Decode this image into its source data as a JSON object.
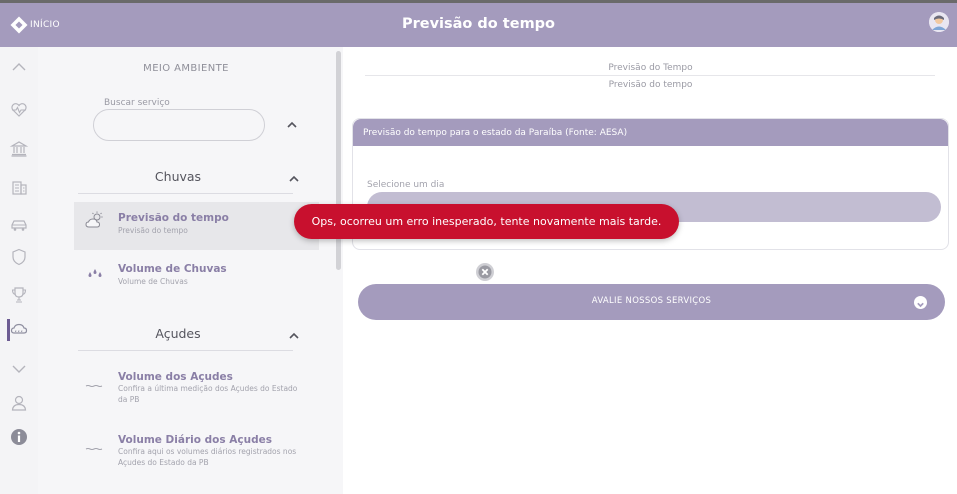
{
  "header": {
    "home_label": "INÍCIO",
    "title": "Previsão do tempo",
    "avatar_icon": "user-avatar-icon"
  },
  "rail": {
    "icons": [
      "chevron-up-icon",
      "heartbeat-icon",
      "bank-building-icon",
      "office-building-icon",
      "car-icon",
      "shield-icon",
      "trophy-icon",
      "cloud-rain-icon",
      "chevron-down-icon",
      "user-icon",
      "info-icon"
    ],
    "active": "cloud-rain-icon"
  },
  "menu": {
    "section_title": "MEIO AMBIENTE",
    "search_label": "Buscar serviço",
    "search_value": "",
    "groups": [
      {
        "title": "Chuvas",
        "items": [
          {
            "title": "Previsão do tempo",
            "desc": "Previsão do tempo",
            "icon": "weather-sun-cloud-icon",
            "active": true
          },
          {
            "title": "Volume de Chuvas",
            "desc": "Volume de Chuvas",
            "icon": "raindrops-icon",
            "active": false
          }
        ]
      },
      {
        "title": "Açudes",
        "items": [
          {
            "title": "Volume dos Açudes",
            "desc": "Confira a última medição dos Açudes do Estado da PB",
            "icon": "water-wave-icon",
            "active": false
          },
          {
            "title": "Volume Diário dos Açudes",
            "desc": "Confira aqui os volumes diários registrados nos Açudes do Estado da PB",
            "icon": "water-wave-icon",
            "active": false
          }
        ]
      }
    ]
  },
  "main": {
    "breadcrumb_1": "Previsão do Tempo",
    "breadcrumb_2": "Previsão do tempo",
    "card_title": "Previsão do tempo para o estado da Paraíba (Fonte: AESA)",
    "day_label": "Selecione um dia",
    "day_value": "",
    "error_message": "Ops, ocorreu um erro inesperado, tente novamente mais tarde.",
    "rate_label": "AVALIE NOSSOS SERVIÇOS"
  },
  "colors": {
    "accent": "#a49bbd",
    "accent_dark": "#6d5c93",
    "error": "#c8102e"
  }
}
